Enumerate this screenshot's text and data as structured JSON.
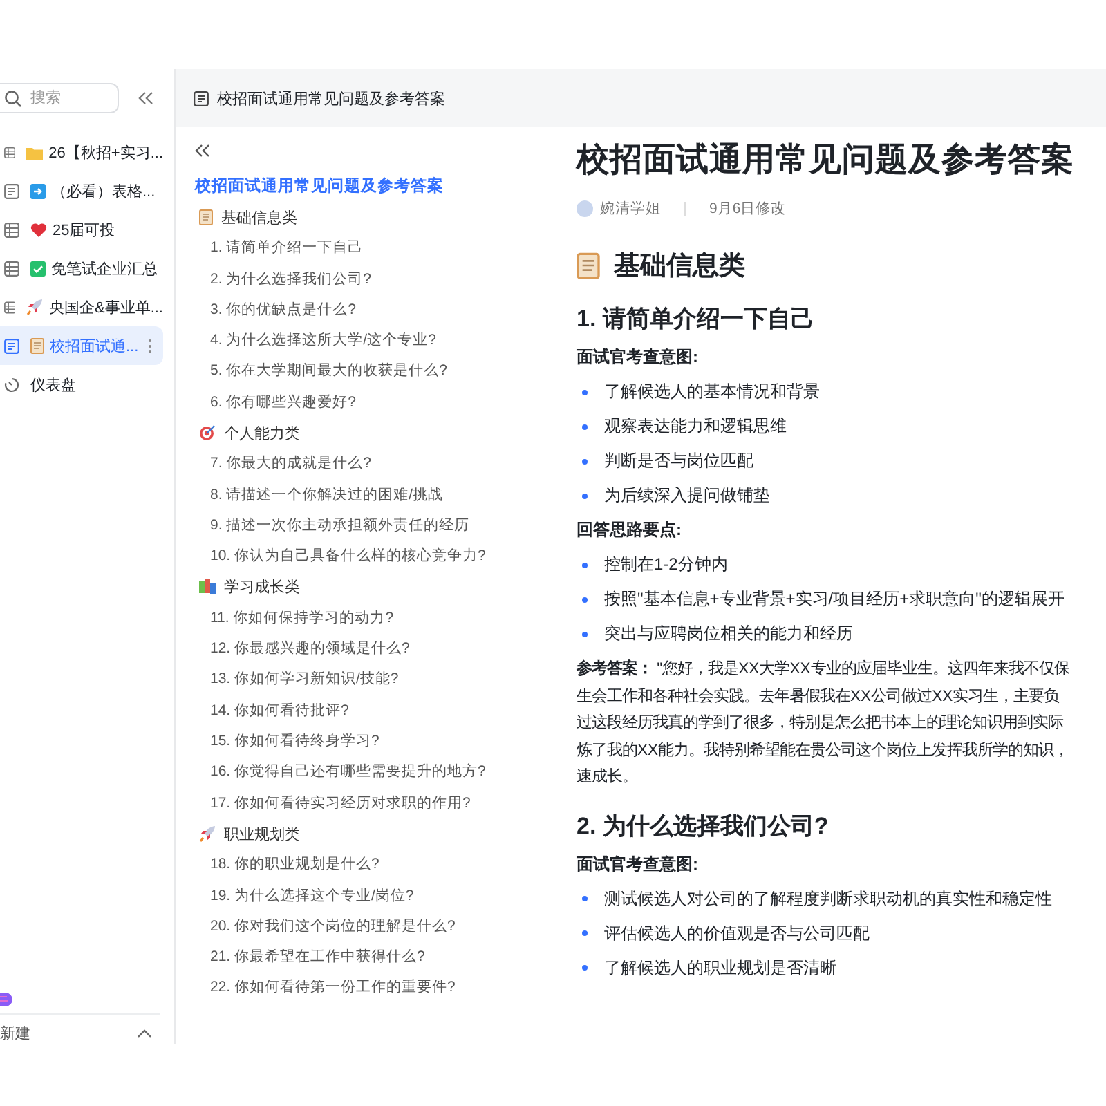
{
  "sidebar": {
    "search": {
      "placeholder": "搜索"
    },
    "items": [
      {
        "label": "26【秋招+实习...",
        "kind": "sheet",
        "selected": false
      },
      {
        "label": "（必看）表格...",
        "kind": "doc",
        "selected": false
      },
      {
        "label": "25届可投",
        "kind": "sheet",
        "selected": false
      },
      {
        "label": "免笔试企业汇总",
        "kind": "sheet",
        "selected": false
      },
      {
        "label": "央国企&事业单...",
        "kind": "sheet",
        "selected": false
      },
      {
        "label": "校招面试通...",
        "kind": "doc",
        "selected": true
      },
      {
        "label": "仪表盘",
        "kind": "dashboard",
        "selected": false
      }
    ],
    "new_label": "新建"
  },
  "topbar": {
    "title": "校招面试通用常见问题及参考答案"
  },
  "toc": {
    "title": "校招面试通用常见问题及参考答案",
    "sections": [
      {
        "heading": "基础信息类",
        "items": [
          "1. 请简单介绍一下自己",
          "2. 为什么选择我们公司?",
          "3. 你的优缺点是什么?",
          "4. 为什么选择这所大学/这个专业?",
          "5. 你在大学期间最大的收获是什么?",
          "6. 你有哪些兴趣爱好?"
        ]
      },
      {
        "heading": "个人能力类",
        "items": [
          "7. 你最大的成就是什么?",
          "8. 请描述一个你解决过的困难/挑战",
          "9. 描述一次你主动承担额外责任的经历",
          "10. 你认为自己具备什么样的核心竞争力?"
        ]
      },
      {
        "heading": "学习成长类",
        "items": [
          "11. 你如何保持学习的动力?",
          "12. 你最感兴趣的领域是什么?",
          "13. 你如何学习新知识/技能?",
          "14. 你如何看待批评?",
          "15. 你如何看待终身学习?",
          "16. 你觉得自己还有哪些需要提升的地方?",
          "17. 你如何看待实习经历对求职的作用?"
        ]
      },
      {
        "heading": "职业规划类",
        "items": [
          "18. 你的职业规划是什么?",
          "19. 为什么选择这个专业/岗位?",
          "20. 你对我们这个岗位的理解是什么?",
          "21. 你最希望在工作中获得什么?",
          "22. 你如何看待第一份工作的重要件?"
        ]
      }
    ]
  },
  "doc": {
    "title": "校招面试通用常见问题及参考答案",
    "author": "婉清学姐",
    "modified": "9月6日修改",
    "blocks": [
      {
        "kind": "h2",
        "text": "基础信息类"
      },
      {
        "kind": "h3",
        "text": "1. 请简单介绍一下自己"
      },
      {
        "kind": "label",
        "text": "面试官考查意图:"
      },
      {
        "kind": "bullet",
        "text": "了解候选人的基本情况和背景"
      },
      {
        "kind": "bullet",
        "text": "观察表达能力和逻辑思维"
      },
      {
        "kind": "bullet",
        "text": "判断是否与岗位匹配"
      },
      {
        "kind": "bullet",
        "text": "为后续深入提问做铺垫"
      },
      {
        "kind": "label",
        "text": "回答思路要点:"
      },
      {
        "kind": "bullet",
        "text": "控制在1-2分钟内"
      },
      {
        "kind": "bullet",
        "text": "按照\"基本信息+专业背景+实习/项目经历+求职意向\"的逻辑展开"
      },
      {
        "kind": "bullet",
        "text": "突出与应聘岗位相关的能力和经历"
      },
      {
        "kind": "para",
        "lines": [
          "**参考答案：** \"您好，我是XX大学XX专业的应届毕业生。这四年来我不仅保",
          "生会工作和各种社会实践。去年暑假我在XX公司做过XX实习生，主要负",
          "过这段经历我真的学到了很多，特别是怎么把书本上的理论知识用到实际",
          "炼了我的XX能力。我特别希望能在贵公司这个岗位上发挥我所学的知识，",
          "速成长。"
        ]
      },
      {
        "kind": "h3",
        "text": "2. 为什么选择我们公司?"
      },
      {
        "kind": "label",
        "text": "面试官考查意图:"
      },
      {
        "kind": "bullet",
        "text": "测试候选人对公司的了解程度判断求职动机的真实性和稳定性"
      },
      {
        "kind": "bullet",
        "text": "评估候选人的价值观是否与公司匹配"
      },
      {
        "kind": "bullet",
        "text": "了解候选人的职业规划是否清晰"
      }
    ]
  }
}
